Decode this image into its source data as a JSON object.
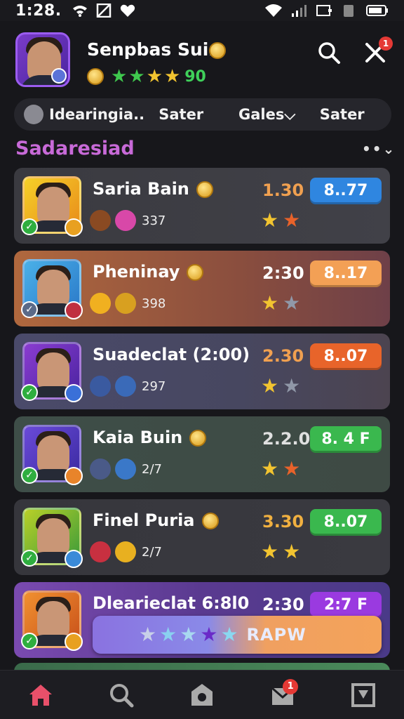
{
  "status_bar": {
    "time": "1:28."
  },
  "header": {
    "player_name": "Senpbas Suin",
    "rating_value": "90",
    "notification_count": "1"
  },
  "tabs": [
    {
      "label": "Idearingia.."
    },
    {
      "label": "Sater"
    },
    {
      "label": "Gales⌵"
    },
    {
      "label": "Sater"
    }
  ],
  "section": {
    "title": "Sadaresiad",
    "more_label": "••⌄"
  },
  "players": [
    {
      "name": "Saria Bain",
      "has_coin": true,
      "count": "337",
      "time": "1.30",
      "time_color": "#f0a050",
      "score": "8..77",
      "score_color": "#2f86e0",
      "card_bg": "linear-gradient(90deg,#3a3a40,#414148)",
      "avatar_bg": "linear-gradient(135deg,#f6d028,#e88a1a)",
      "check_color": "#2fae3f",
      "corner_color": "#e8a020",
      "icon1_color": "#8a4a22",
      "icon2_color": "#d848a8",
      "star2_color": "#e8622a"
    },
    {
      "name": "Pheninay",
      "has_coin": true,
      "count": "398",
      "time": "2:30",
      "time_color": "#ffffff",
      "score": "8..17",
      "score_color": "#f3a055",
      "card_bg": "linear-gradient(90deg,#b0683e,#8a4e3e 60%,#6e4048)",
      "avatar_bg": "linear-gradient(135deg,#4ab0e8,#2a78c8)",
      "check_color": "#5a6a88",
      "corner_color": "#c03040",
      "icon1_color": "#f0b020",
      "icon2_color": "#d8a020",
      "star2_color": "#9098a8"
    },
    {
      "name": "Suadeclat (2:00)",
      "has_coin": false,
      "count": "297",
      "time": "2.30",
      "time_color": "#f0a050",
      "score": "8..07",
      "score_color": "#e8642a",
      "card_bg": "linear-gradient(90deg,#4a4a6a,#474760 60%,#4c4450)",
      "avatar_bg": "linear-gradient(135deg,#8a3cd0,#4a24a0)",
      "check_color": "#2fae3f",
      "corner_color": "#3a70d8",
      "icon1_color": "#3a5aa0",
      "icon2_color": "#3a6ab8",
      "star2_color": "#9098a8"
    },
    {
      "name": "Kaia Buin",
      "has_coin": true,
      "count": "2/7",
      "time": "2.2.0",
      "time_color": "#e0e0e0",
      "score": "8. 4 F",
      "score_color": "#3ab84e",
      "card_bg": "linear-gradient(90deg,#3e4e48,#3e4a44)",
      "avatar_bg": "linear-gradient(135deg,#6a4ad8,#3a2aa0)",
      "check_color": "#2fae3f",
      "corner_color": "#e8842a",
      "icon1_color": "#4a5a88",
      "icon2_color": "#3a78c8",
      "star2_color": "#e8622a"
    },
    {
      "name": "Finel Puria",
      "has_coin": true,
      "count": "2/7",
      "time": "3.30",
      "time_color": "#f0b040",
      "score": "8..07",
      "score_color": "#3ab84e",
      "card_bg": "linear-gradient(90deg,#36363c,#3a3a40)",
      "avatar_bg": "linear-gradient(135deg,#b8d028,#3a9a3a)",
      "check_color": "#2fae3f",
      "corner_color": "#3a8ad8",
      "icon1_color": "#c83040",
      "icon2_color": "#e8b020",
      "star2_color": "#f2c430"
    },
    {
      "name": "Dlearieclat 6:8l0",
      "has_coin": false,
      "count": "",
      "time": "2:30",
      "time_color": "#ffffff",
      "score": "2:7 F",
      "score_color": "#9a3ae0",
      "card_bg": "linear-gradient(90deg,#7a4ab0,#5a3a90 50%,#4a3a88)",
      "avatar_bg": "linear-gradient(135deg,#f09030,#c8501a)",
      "check_color": "#2fae3f",
      "corner_color": "#e8a020",
      "icon1_color": "#000000",
      "icon2_color": "#000000",
      "star2_color": "#f2c430",
      "banner": {
        "label": "RAPW"
      }
    }
  ],
  "colors": {
    "star_gold": "#f2c430",
    "accent_purple": "#c86ad8",
    "rating_green": "#3fd05a",
    "home_pink": "#e8506a"
  },
  "bottom_nav": {
    "mail_badge": "1"
  }
}
